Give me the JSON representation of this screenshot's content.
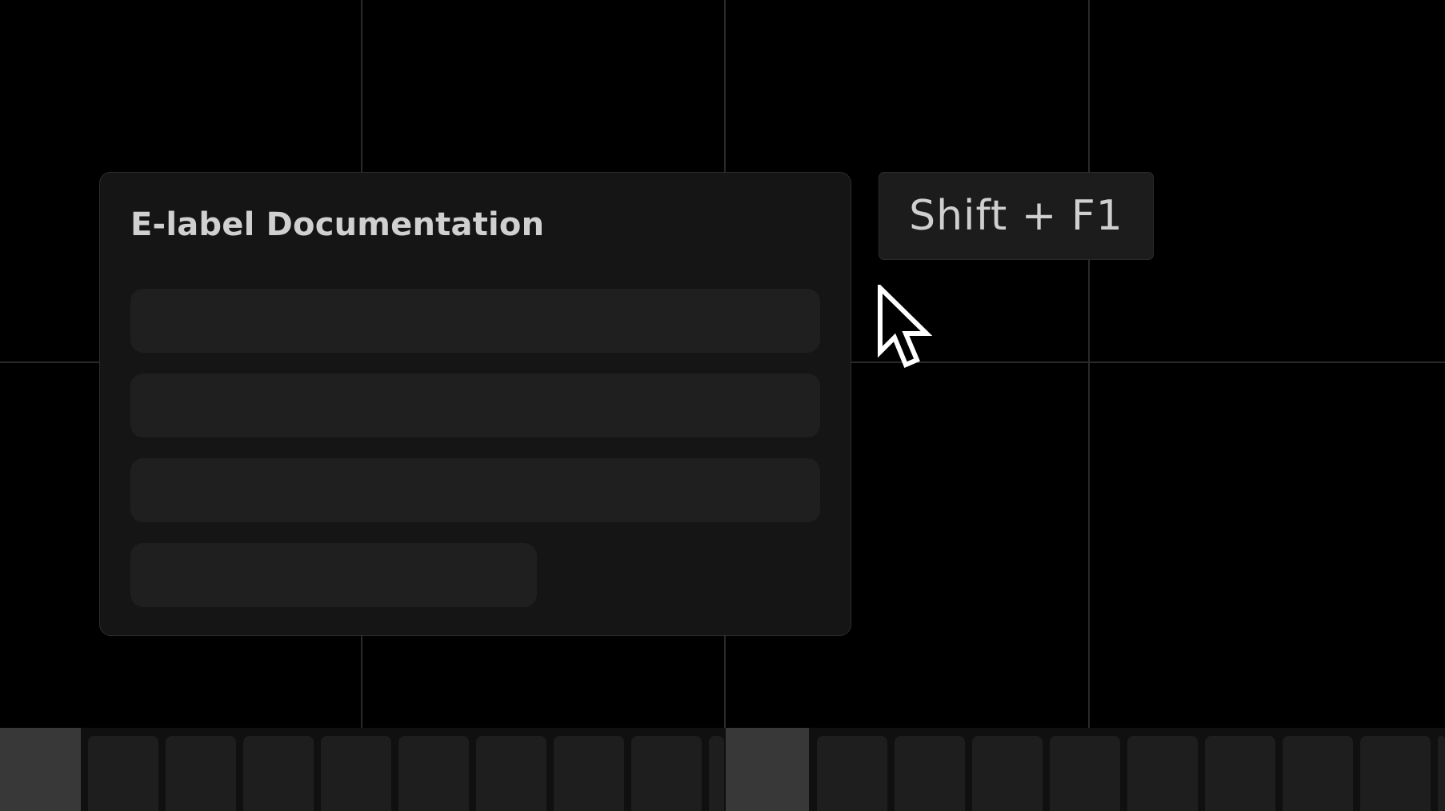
{
  "doc_card": {
    "title": "E-label Documentation",
    "placeholder_rows": 4
  },
  "shortcut": {
    "label": "Shift + F1"
  },
  "cursor": {
    "icon": "arrow-pointer-icon"
  },
  "filmstrip": {
    "tiles_per_group": 8
  },
  "colors": {
    "background": "#000000",
    "card": "#151515",
    "placeholder": "#1f1f1f",
    "badge": "#1c1c1c",
    "text": "#d0d0d0",
    "grid": "#2a2a2a"
  }
}
